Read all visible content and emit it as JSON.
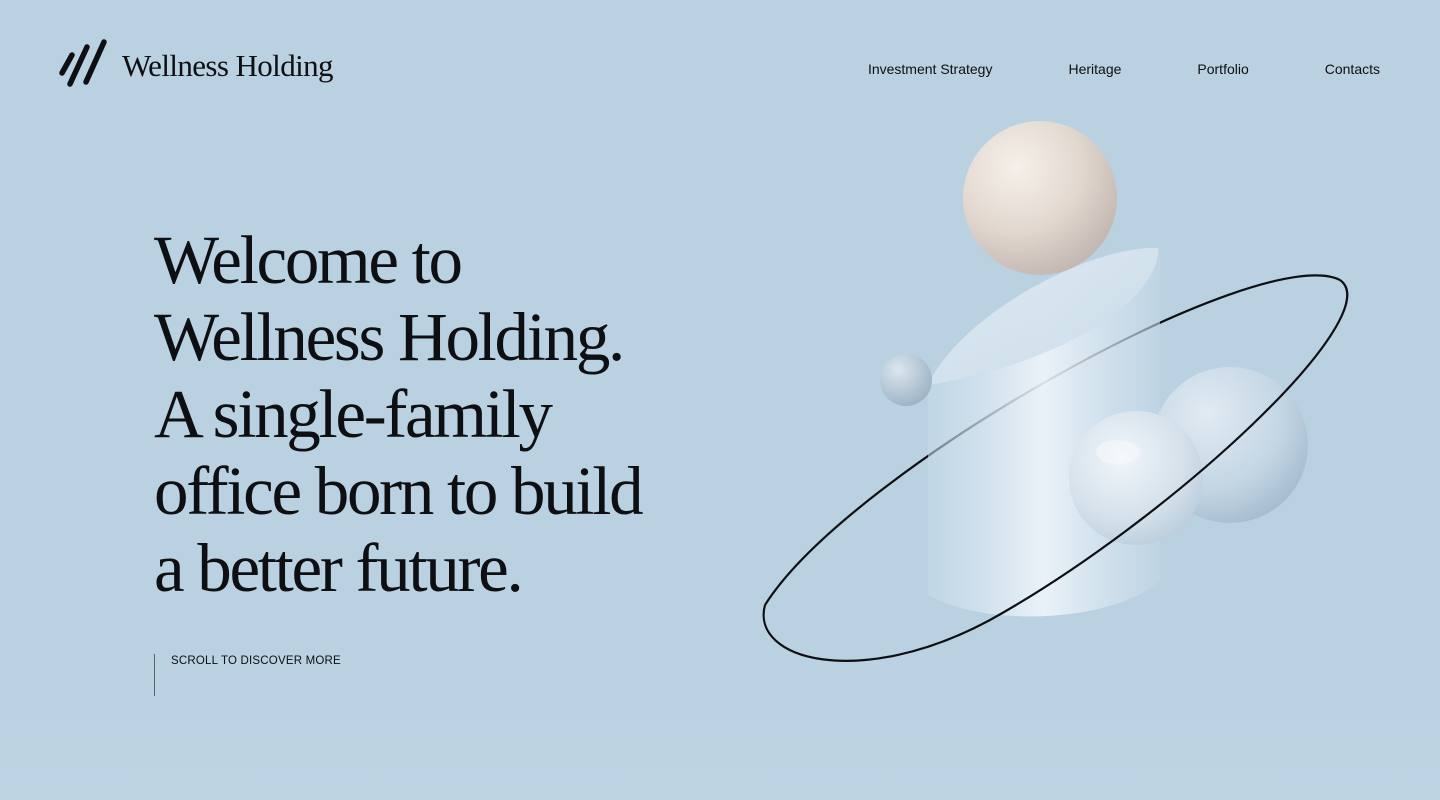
{
  "brand": {
    "name": "Wellness Holding",
    "logo_icon": "slash-marks-logo"
  },
  "nav": {
    "items": [
      {
        "label": "Investment Strategy"
      },
      {
        "label": "Heritage"
      },
      {
        "label": "Portfolio"
      },
      {
        "label": "Contacts"
      }
    ]
  },
  "hero": {
    "lines": [
      "Welcome to",
      "Wellness Holding.",
      "A single-family",
      "office born to build",
      "a better future."
    ],
    "scroll_cta": "SCROLL TO DISCOVER MORE"
  },
  "colors": {
    "background": "#b9d1e1",
    "text": "#0d0f13"
  }
}
